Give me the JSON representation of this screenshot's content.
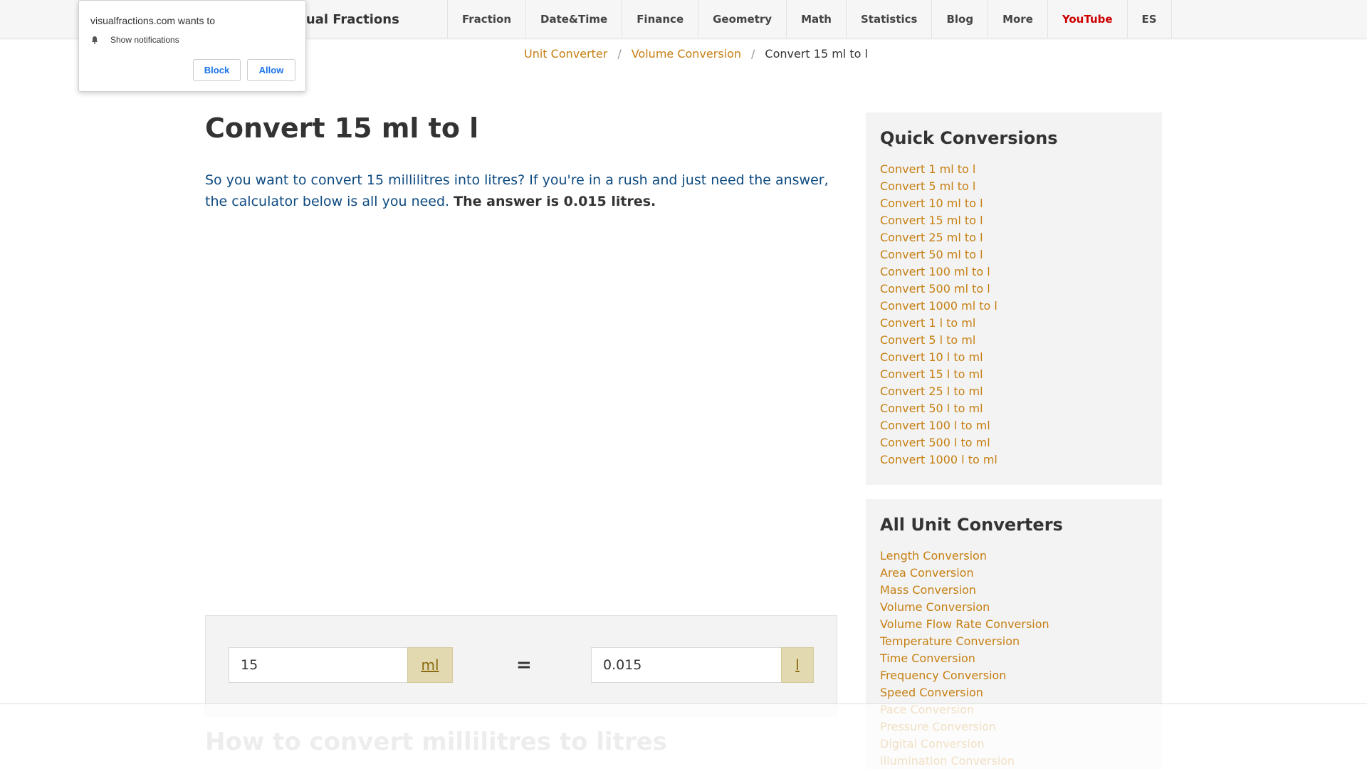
{
  "header": {
    "brand": "isual Fractions",
    "nav": [
      "Fraction",
      "Date&Time",
      "Finance",
      "Geometry",
      "Math",
      "Statistics",
      "Blog",
      "More",
      "YouTube",
      "ES"
    ]
  },
  "breadcrumb": {
    "items": [
      "Unit Converter",
      "Volume Conversion"
    ],
    "separator": "/",
    "current": "Convert 15 ml to l"
  },
  "notification": {
    "title": "visualfractions.com wants to",
    "permission": "Show notifications",
    "block_label": "Block",
    "allow_label": "Allow"
  },
  "main": {
    "title": "Convert 15 ml to l",
    "intro": "So you want to convert 15 millilitres into litres? If you're in a rush and just need the answer, the calculator below is all you need.",
    "answer": "The answer is 0.015 litres.",
    "converter": {
      "from_value": "15",
      "from_unit": "ml",
      "equals": "=",
      "to_value": "0.015",
      "to_unit": "l"
    },
    "how_title": "How to convert millilitres to litres"
  },
  "sidebar": {
    "quick_title": "Quick Conversions",
    "quick_links": [
      "Convert 1 ml to l",
      "Convert 5 ml to l",
      "Convert 10 ml to l",
      "Convert 15 ml to l",
      "Convert 25 ml to l",
      "Convert 50 ml to l",
      "Convert 100 ml to l",
      "Convert 500 ml to l",
      "Convert 1000 ml to l",
      "Convert 1 l to ml",
      "Convert 5 l to ml",
      "Convert 10 l to ml",
      "Convert 15 l to ml",
      "Convert 25 l to ml",
      "Convert 50 l to ml",
      "Convert 100 l to ml",
      "Convert 500 l to ml",
      "Convert 1000 l to ml"
    ],
    "all_title": "All Unit Converters",
    "all_links": [
      "Length Conversion",
      "Area Conversion",
      "Mass Conversion",
      "Volume Conversion",
      "Volume Flow Rate Conversion",
      "Temperature Conversion",
      "Time Conversion",
      "Frequency Conversion",
      "Speed Conversion",
      "Pace Conversion",
      "Pressure Conversion",
      "Digital Conversion",
      "Illumination Conversion"
    ]
  }
}
